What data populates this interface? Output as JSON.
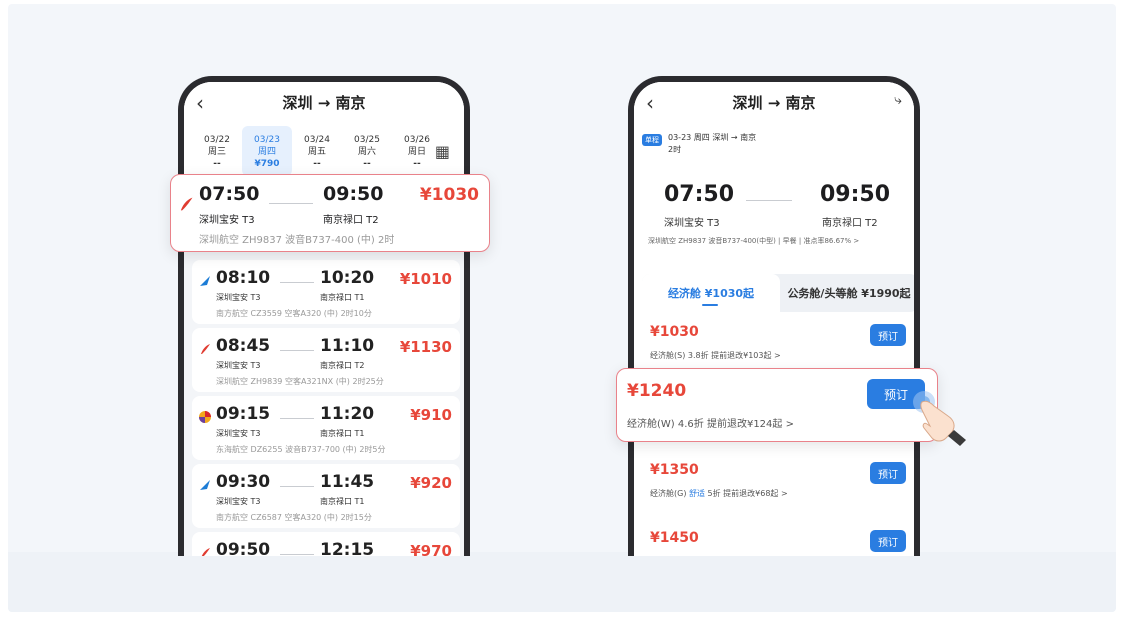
{
  "left": {
    "title": "深圳 → 南京",
    "dates": [
      {
        "date": "03/22",
        "weekday": "周三",
        "price": "--"
      },
      {
        "date": "03/23",
        "weekday": "周四",
        "price": "¥790",
        "selected": true
      },
      {
        "date": "03/24",
        "weekday": "周五",
        "price": "--"
      },
      {
        "date": "03/25",
        "weekday": "周六",
        "price": "--"
      },
      {
        "date": "03/26",
        "weekday": "周日",
        "price": "--"
      }
    ],
    "highlight": {
      "dep": "07:50",
      "arr": "09:50",
      "price": "¥1030",
      "from": "深圳宝安 T3",
      "to": "南京禄口 T2",
      "meta": "深圳航空 ZH9837  波音B737-400 (中)   2时"
    },
    "flights": [
      {
        "dep": "08:10",
        "arr": "10:20",
        "price": "¥1010",
        "from": "深圳宝安 T3",
        "to": "南京禄口 T1",
        "meta": "南方航空 CZ3559   空客A320 (中)   2时10分",
        "logo_color": "#1c7cd6"
      },
      {
        "dep": "08:45",
        "arr": "11:10",
        "price": "¥1130",
        "from": "深圳宝安 T3",
        "to": "南京禄口 T2",
        "meta": "深圳航空 ZH9839   空客A321NX (中)   2时25分",
        "logo_color": "#e03c31"
      },
      {
        "dep": "09:15",
        "arr": "11:20",
        "price": "¥910",
        "from": "深圳宝安 T3",
        "to": "南京禄口 T1",
        "meta": "东海航空 DZ6255   波音B737-700 (中)   2时5分",
        "logo_color": "#f2a81d"
      },
      {
        "dep": "09:30",
        "arr": "11:45",
        "price": "¥920",
        "from": "深圳宝安 T3",
        "to": "南京禄口 T1",
        "meta": "南方航空 CZ6587   空客A320 (中)   2时15分",
        "logo_color": "#1c7cd6"
      },
      {
        "dep": "09:50",
        "arr": "12:15",
        "price": "¥970",
        "from": "",
        "to": "",
        "meta": "",
        "logo_color": "#e03c31"
      }
    ]
  },
  "right": {
    "title": "深圳 → 南京",
    "trip_tag": "单程",
    "trip_date": "03-23 周四 深圳 → 南京",
    "trip_duration": "2时",
    "dep": "07:50",
    "arr": "09:50",
    "from": "深圳宝安 T3",
    "to": "南京禄口 T2",
    "flight_info": "深圳航空 ZH9837 波音B737-400(中型) | 早餐 | 准点率86.67% >",
    "tab_economy": "经济舱 ¥1030起",
    "tab_business": "公务舱/头等舱 ¥1990起",
    "fares": [
      {
        "price": "¥1030",
        "desc": "经济舱(S) 3.8折   提前退改¥103起 >",
        "button": "预订"
      },
      {
        "price": "¥1350",
        "desc_a": "经济舱(G) ",
        "comfort": "舒适",
        "desc_b": " 5折   提前退改¥68起 >",
        "button": "预订"
      },
      {
        "price": "¥1450",
        "desc": "",
        "button": "预订"
      }
    ],
    "highlight": {
      "price": "¥1240",
      "desc": "经济舱(W) 4.6折   提前退改¥124起 >",
      "button": "预订"
    }
  },
  "colors": {
    "accent": "#2a7de1",
    "price": "#e7473a",
    "highlight_border": "#e9828a"
  },
  "icons": {
    "back": "chevron-left-icon",
    "calendar": "calendar-icon",
    "route": "route-icon",
    "hand": "pointing-hand-icon"
  }
}
